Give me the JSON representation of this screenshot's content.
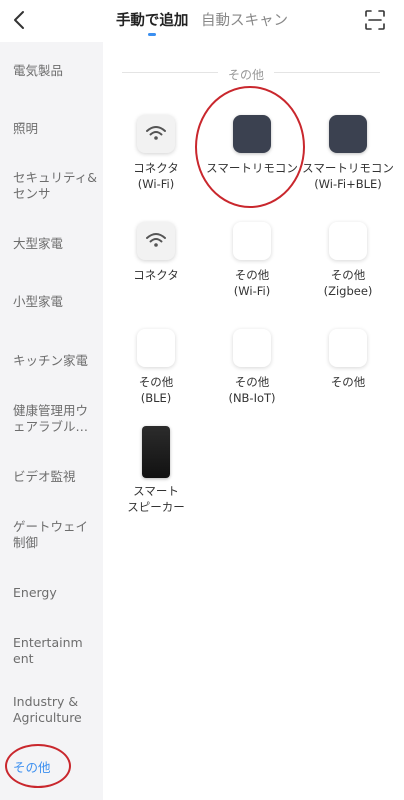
{
  "header": {
    "tabs": [
      {
        "label": "手動で追加",
        "active": true
      },
      {
        "label": "自動スキャン",
        "active": false
      }
    ]
  },
  "sidebar": {
    "items": [
      {
        "label": "電気製品"
      },
      {
        "label": "照明"
      },
      {
        "label": "セキュリティ&センサ"
      },
      {
        "label": "大型家電"
      },
      {
        "label": "小型家電"
      },
      {
        "label": "キッチン家電"
      },
      {
        "label": "健康管理用ウェアラブル…"
      },
      {
        "label": "ビデオ監視"
      },
      {
        "label": "ゲートウェイ制御"
      },
      {
        "label": "Energy"
      },
      {
        "label": "Entertainment"
      },
      {
        "label": "Industry & Agriculture"
      },
      {
        "label": "その他",
        "active": true
      }
    ]
  },
  "main": {
    "section_title": "その他",
    "devices": [
      {
        "label": "コネクタ (Wi-Fi)",
        "line1": "コネクタ",
        "line2": "(Wi-Fi)",
        "icon": "wifi-icon"
      },
      {
        "label": "スマートリモコン",
        "line1": "スマートリモコン",
        "line2": "",
        "icon": "remote-icon"
      },
      {
        "label": "スマートリモコン (Wi-Fi+BLE)",
        "line1": "スマートリモコン",
        "line2": "(Wi-Fi+BLE)",
        "icon": "remote-icon"
      },
      {
        "label": "コネクタ",
        "line1": "コネクタ",
        "line2": "",
        "icon": "wifi-icon"
      },
      {
        "label": "その他 (Wi-Fi)",
        "line1": "その他",
        "line2": "(Wi-Fi)",
        "icon": "device-icon"
      },
      {
        "label": "その他 (Zigbee)",
        "line1": "その他",
        "line2": "(Zigbee)",
        "icon": "device-icon"
      },
      {
        "label": "その他 (BLE)",
        "line1": "その他",
        "line2": "(BLE)",
        "icon": "device-icon"
      },
      {
        "label": "その他 (NB-IoT)",
        "line1": "その他",
        "line2": "(NB-IoT)",
        "icon": "device-icon"
      },
      {
        "label": "その他",
        "line1": "その他",
        "line2": "",
        "icon": "device-icon"
      },
      {
        "label": "スマートスピーカー",
        "line1": "スマート",
        "line2": "スピーカー",
        "icon": "speaker-icon"
      }
    ]
  },
  "colors": {
    "accent": "#3b8ff0",
    "annotation": "#c9272d",
    "sidebar_bg": "#f4f4f6",
    "remote_icon": "#3b4150"
  }
}
